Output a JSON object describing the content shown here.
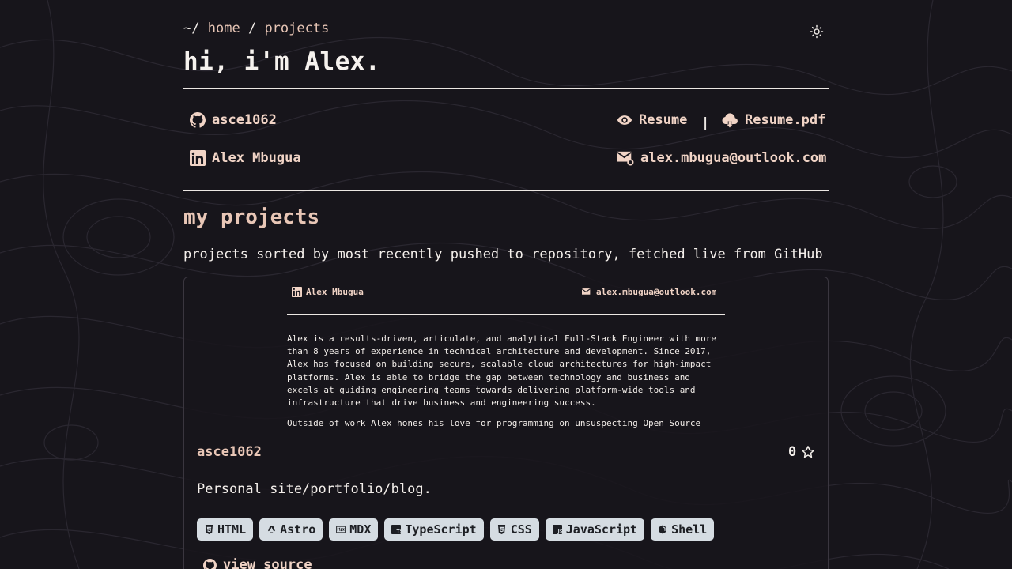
{
  "breadcrumb": {
    "root": "~/",
    "home": "home",
    "sep": "/",
    "current": "projects"
  },
  "header": {
    "title": "hi, i'm Alex."
  },
  "links": {
    "github": "asce1062",
    "linkedin": "Alex Mbugua",
    "resume": "Resume",
    "separator": "|",
    "resume_pdf": "Resume.pdf",
    "email": "alex.mbugua@outlook.com"
  },
  "projects": {
    "heading": "my projects",
    "subtitle": "projects sorted by most recently pushed to repository, fetched live from GitHub"
  },
  "card": {
    "preview": {
      "linkedin": "Alex Mbugua",
      "email": "alex.mbugua@outlook.com",
      "paragraph1_lines": [
        "Alex is a results-driven, articulate, and analytical Full-Stack Engineer with more",
        "than 8 years of experience in technical architecture and development. Since 2017,",
        "Alex has focused on building secure, scalable cloud architectures for high-impact",
        "platforms. Alex is able to bridge the gap between technology and business and",
        "excels at guiding engineering teams towards delivering platform-wide tools and",
        "infrastructure that drive business and engineering success."
      ],
      "paragraph2": "Outside of work Alex hones his love for programming on unsuspecting Open Source"
    },
    "repo_name": "asce1062",
    "stars": "0",
    "description": "Personal site/portfolio/blog.",
    "tags": [
      {
        "label": "HTML",
        "icon": "html5-icon"
      },
      {
        "label": "Astro",
        "icon": "astro-icon"
      },
      {
        "label": "MDX",
        "icon": "mdx-icon"
      },
      {
        "label": "TypeScript",
        "icon": "typescript-icon"
      },
      {
        "label": "CSS",
        "icon": "css3-icon"
      },
      {
        "label": "JavaScript",
        "icon": "javascript-icon"
      },
      {
        "label": "Shell",
        "icon": "shell-icon"
      }
    ],
    "view_source": "view source"
  },
  "colors": {
    "background": "#17151b",
    "accent": "#e8c6b6",
    "text": "#ece7e3",
    "tag_bg": "#d5dce2"
  }
}
